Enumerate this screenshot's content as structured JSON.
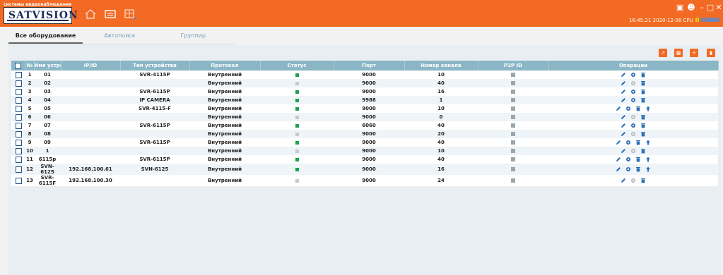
{
  "app": {
    "logo_tagline": "системы видеонаблюдения",
    "logo_name": "SATVISION",
    "status_line": "16:45:21 2020-12-08 CPU"
  },
  "tabs": [
    "Все оборудование",
    "Автопоиск",
    "Группир."
  ],
  "toolbar": {
    "icons": [
      "export-icon",
      "import-icon",
      "add-icon",
      "delete-icon"
    ]
  },
  "table": {
    "headers": [
      "№",
      "Имя устройства",
      "IP/ID",
      "Тип устройства",
      "Протокол",
      "Статус",
      "Порт",
      "Номер канала",
      "P2P ID",
      "Операции"
    ],
    "rows": [
      {
        "n": "1",
        "name": "01",
        "ip": "",
        "type": "SVR-4115P",
        "proto": "Внутренний",
        "online": true,
        "port": "9000",
        "channels": "10",
        "ops": 3
      },
      {
        "n": "2",
        "name": "02",
        "ip": "",
        "type": "",
        "proto": "Внутренний",
        "online": false,
        "port": "9000",
        "channels": "40",
        "ops": 3
      },
      {
        "n": "3",
        "name": "03",
        "ip": "",
        "type": "SVR-6115P",
        "proto": "Внутренний",
        "online": true,
        "port": "9000",
        "channels": "16",
        "ops": 3
      },
      {
        "n": "4",
        "name": "04",
        "ip": "",
        "type": "IP CAMERA",
        "proto": "Внутренний",
        "online": true,
        "port": "9988",
        "channels": "1",
        "ops": 3
      },
      {
        "n": "5",
        "name": "05",
        "ip": "",
        "type": "SVR-4115-F",
        "proto": "Внутренний",
        "online": true,
        "port": "9000",
        "channels": "10",
        "ops": 4
      },
      {
        "n": "6",
        "name": "06",
        "ip": "",
        "type": "",
        "proto": "Внутренний",
        "online": false,
        "port": "9000",
        "channels": "0",
        "ops": 3
      },
      {
        "n": "7",
        "name": "07",
        "ip": "",
        "type": "SVR-6115P",
        "proto": "Внутренний",
        "online": true,
        "port": "6060",
        "channels": "40",
        "ops": 3
      },
      {
        "n": "8",
        "name": "08",
        "ip": "",
        "type": "",
        "proto": "Внутренний",
        "online": false,
        "port": "9000",
        "channels": "20",
        "ops": 3
      },
      {
        "n": "9",
        "name": "09",
        "ip": "",
        "type": "SVR-6115P",
        "proto": "Внутренний",
        "online": true,
        "port": "9000",
        "channels": "40",
        "ops": 4
      },
      {
        "n": "10",
        "name": "1",
        "ip": "",
        "type": "",
        "proto": "Внутренний",
        "online": false,
        "port": "9000",
        "channels": "10",
        "ops": 3
      },
      {
        "n": "11",
        "name": "6115p",
        "ip": "",
        "type": "SVR-6115P",
        "proto": "Внутренний",
        "online": true,
        "port": "9000",
        "channels": "40",
        "ops": 4
      },
      {
        "n": "12",
        "name": "SVN-6125",
        "ip": "192.168.100.61",
        "type": "SVN-6125",
        "proto": "Внутренний",
        "online": true,
        "port": "9000",
        "channels": "16",
        "ops": 4
      },
      {
        "n": "13",
        "name": "SVR-6115F",
        "ip": "192.168.100.30",
        "type": "",
        "proto": "Внутренний",
        "online": false,
        "port": "9000",
        "channels": "24",
        "ops": 3
      }
    ]
  },
  "colors": {
    "accent": "#f26a23",
    "header": "#8ab6c6",
    "online": "#1aa34a",
    "offline": "#c9c9c9",
    "icon": "#2a6fb8"
  }
}
